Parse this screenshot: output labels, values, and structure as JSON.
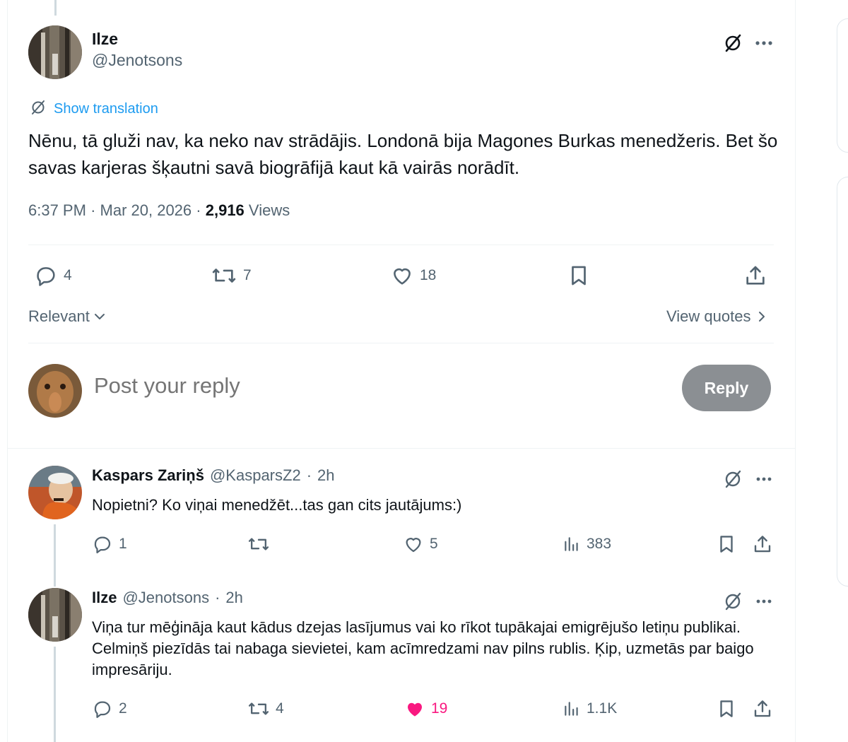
{
  "main_tweet": {
    "author_name": "Ilze",
    "author_handle": "@Jenotsons",
    "show_translation": "Show translation",
    "text": "Nēnu, tā gluži nav, ka neko nav strādājis. Londonā bija Magones Burkas menedžeris. Bet šo savas karjeras šķautni savā biogrāfijā kaut kā vairās norādīt.",
    "time": "6:37 PM",
    "date": "Mar 20, 2026",
    "views_count": "2,916",
    "views_label": "Views",
    "separator": "·",
    "replies": "4",
    "reposts": "7",
    "likes": "18"
  },
  "sort": {
    "label": "Relevant",
    "view_quotes": "View quotes"
  },
  "composer": {
    "placeholder": "Post your reply",
    "reply_button": "Reply"
  },
  "replies": [
    {
      "name": "Kaspars Zariņš",
      "handle": "@KasparsZ2",
      "time": "2h",
      "text": "Nopietni? Ko viņai menedžēt...tas gan cits jautājums:)",
      "replies": "1",
      "reposts": "",
      "likes": "5",
      "views": "383",
      "liked": false
    },
    {
      "name": "Ilze",
      "handle": "@Jenotsons",
      "time": "2h",
      "text": "Viņa tur mēģināja kaut kādus dzejas lasījumus vai ko rīkot tupākajai emigrējušo letiņu publikai. Celmiņš piezīdās tai nabaga sievietei, kam acīmredzami nav pilns rublis. Ķip, uzmetās par baigo impresāriju.",
      "replies": "2",
      "reposts": "4",
      "likes": "19",
      "views": "1.1K",
      "liked": true
    }
  ],
  "colors": {
    "accent": "#1d9bf0",
    "like": "#f91880",
    "secondary_text": "#536471",
    "reply_button": "#8b8f93"
  }
}
